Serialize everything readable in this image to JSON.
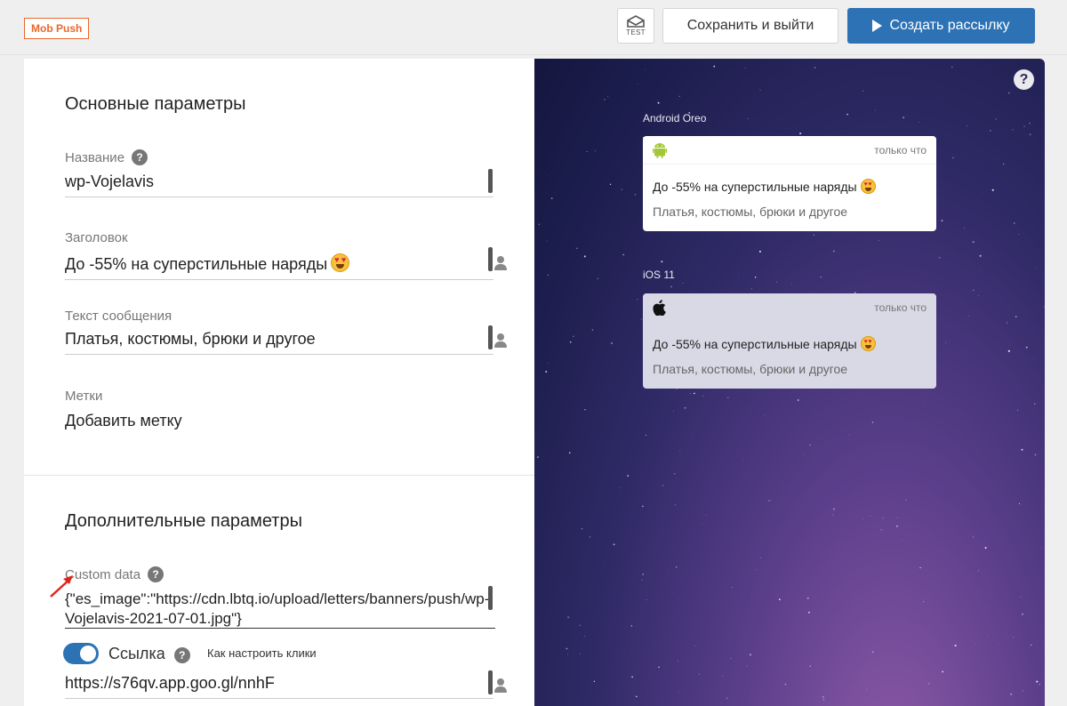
{
  "header": {
    "tag": "Mob Push",
    "test_label": "TEST",
    "save_label": "Сохранить и выйти",
    "create_label": "Создать рассылку"
  },
  "basic": {
    "section_title": "Основные параметры",
    "name_label": "Название",
    "name_value": "wp-Vojelavis",
    "title_label": "Заголовок",
    "title_value": "До -55% на суперстильные наряды",
    "text_label": "Текст сообщения",
    "text_value": "Платья, костюмы, брюки и другое",
    "tags_label": "Метки",
    "tags_add": "Добавить метку"
  },
  "extra": {
    "section_title": "Дополнительные параметры",
    "custom_label": "Custom data",
    "custom_value": "{\"es_image\":\"https://cdn.lbtq.io/upload/letters/banners/push/wp-Vojelavis-2021-07-01.jpg\"}",
    "link_label": "Ссылка",
    "link_enabled": true,
    "how_label": "Как настроить клики",
    "link_value": "https://s76qv.app.goo.gl/nnhF"
  },
  "preview": {
    "android": {
      "os_label": "Android Oreo",
      "time": "только что",
      "title": "До -55% на суперстильные наряды",
      "body": "Платья, костюмы, брюки и другое"
    },
    "ios": {
      "os_label": "iOS 11",
      "time": "только что",
      "title": "До -55% на суперстильные наряды",
      "body": "Платья, костюмы, брюки и другое"
    }
  },
  "colors": {
    "accent": "#2e72b6",
    "tag": "#e8682c",
    "arrow": "#e0241b"
  },
  "icons": [
    "test-envelope-icon",
    "play-icon",
    "help-icon",
    "variable-bar-icon",
    "person-icon",
    "android-icon",
    "apple-icon",
    "annotation-arrow-icon"
  ]
}
